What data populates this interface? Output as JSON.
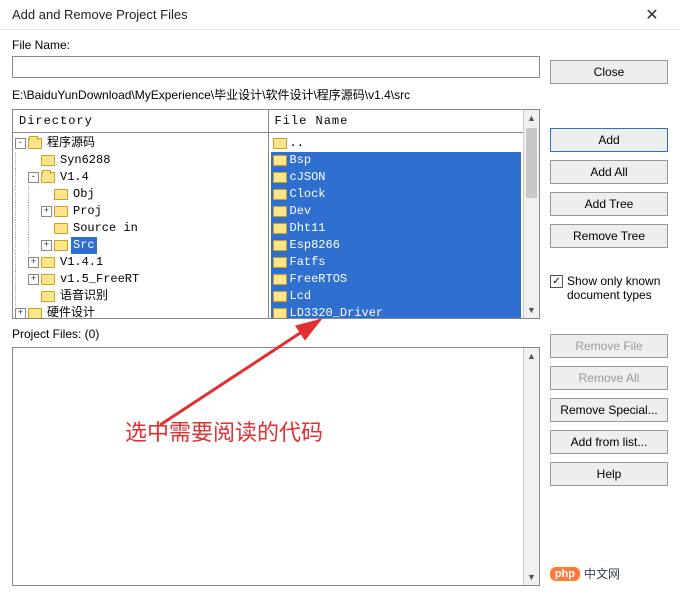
{
  "window": {
    "title": "Add and Remove Project Files",
    "close": "✕"
  },
  "labels": {
    "file_name": "File Name:",
    "path": "E:\\BaiduYunDownload\\MyExperience\\毕业设计\\软件设计\\程序源码\\v1.4\\src",
    "directory_header": "Directory",
    "filelist_header": "File Name",
    "project_files": "Project Files: (0)"
  },
  "inputs": {
    "file_name_value": ""
  },
  "buttons": {
    "close": "Close",
    "add": "Add",
    "add_all": "Add All",
    "add_tree": "Add Tree",
    "remove_tree": "Remove Tree",
    "remove_file": "Remove File",
    "remove_all": "Remove All",
    "remove_special": "Remove Special...",
    "add_from_list": "Add from list...",
    "help": "Help"
  },
  "checkbox": {
    "show_only_known": "Show only known document types",
    "checked": true
  },
  "tree": [
    {
      "indent": 0,
      "toggle": "-",
      "icon": "folder",
      "label": "程序源码",
      "sel": false
    },
    {
      "indent": 1,
      "toggle": "",
      "icon": "folder",
      "label": "Syn6288",
      "sel": false
    },
    {
      "indent": 1,
      "toggle": "-",
      "icon": "folder",
      "label": "V1.4",
      "sel": false
    },
    {
      "indent": 2,
      "toggle": "",
      "icon": "folder",
      "label": "Obj",
      "sel": false
    },
    {
      "indent": 2,
      "toggle": "+",
      "icon": "folder",
      "label": "Proj",
      "sel": false
    },
    {
      "indent": 2,
      "toggle": "",
      "icon": "folder",
      "label": "Source in",
      "sel": false
    },
    {
      "indent": 2,
      "toggle": "+",
      "icon": "folder",
      "label": "Src",
      "sel": true
    },
    {
      "indent": 1,
      "toggle": "+",
      "icon": "folder",
      "label": "V1.4.1",
      "sel": false
    },
    {
      "indent": 1,
      "toggle": "+",
      "icon": "folder",
      "label": "v1.5_FreeRT",
      "sel": false
    },
    {
      "indent": 1,
      "toggle": "",
      "icon": "folder",
      "label": "语音识别",
      "sel": false
    },
    {
      "indent": 0,
      "toggle": "+",
      "icon": "folder",
      "label": "硬件设计",
      "sel": false
    }
  ],
  "files": [
    {
      "label": "..",
      "sel": false,
      "up": true
    },
    {
      "label": "Bsp",
      "sel": true
    },
    {
      "label": "cJSON",
      "sel": true
    },
    {
      "label": "Clock",
      "sel": true
    },
    {
      "label": "Dev",
      "sel": true
    },
    {
      "label": "Dht11",
      "sel": true
    },
    {
      "label": "Esp8266",
      "sel": true
    },
    {
      "label": "Fatfs",
      "sel": true
    },
    {
      "label": "FreeRTOS",
      "sel": true
    },
    {
      "label": "Lcd",
      "sel": true
    },
    {
      "label": "LD3320_Driver",
      "sel": true
    }
  ],
  "annotation": {
    "text": "选中需要阅读的代码"
  },
  "badge": {
    "logo": "php",
    "text": "中文网"
  }
}
